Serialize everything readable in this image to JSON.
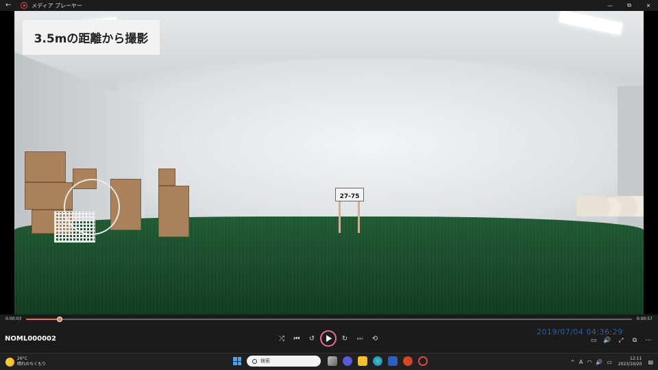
{
  "window": {
    "title": "メディア プレーヤー",
    "back": "←",
    "minimize": "—",
    "maximize": "⧉",
    "close": "✕"
  },
  "overlay": {
    "caption": "3.5mの距離から撮影",
    "plate_text": "27-75"
  },
  "player": {
    "current_time": "0:00:03",
    "duration": "0:00:57",
    "progress_fraction": 0.055,
    "file_name": "NOML000002",
    "timestamp": "2019/07/04 04:36:29",
    "controls": {
      "shuffle": "⤮",
      "prev": "⏮",
      "rewind": "↺",
      "forward": "↻",
      "next": "⏭",
      "repeat": "⟲"
    },
    "right_controls": {
      "miniplayer": "▭",
      "volume": "🔊",
      "fullscreen": "⤢",
      "cast": "⧉",
      "more": "⋯"
    }
  },
  "taskbar": {
    "weather_temp": "26°C",
    "weather_desc": "晴れのちくもり",
    "search_placeholder": "検索",
    "tray_chevron": "^",
    "ime": "A",
    "wifi": "◠",
    "sound": "🔊",
    "battery": "▭",
    "clock_time": "12:11",
    "clock_date": "2023/10/20",
    "notification": "▤"
  },
  "colors": {
    "accent": "#e8784a",
    "play_ring": "#e56f9a",
    "timestamp": "#2a5fa8"
  }
}
